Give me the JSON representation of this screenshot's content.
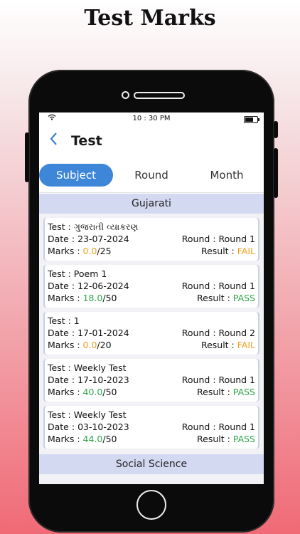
{
  "headline": "Test Marks",
  "status_bar": {
    "time": "10 : 30 PM"
  },
  "appbar": {
    "title": "Test"
  },
  "tabs": [
    "Subject",
    "Round",
    "Month"
  ],
  "labels": {
    "test": "Test",
    "date": "Date",
    "marks": "Marks",
    "round": "Round",
    "result": "Result",
    "sep": " : "
  },
  "sections": [
    {
      "name": "Gujarati",
      "items": [
        {
          "test": "ગુજરાતી વ્યાકરણ",
          "date": "23-07-2024",
          "round": "Round 1",
          "marks": "0.0",
          "total": "/25",
          "result": "FAIL"
        },
        {
          "test": "Poem 1",
          "date": "12-06-2024",
          "round": "Round 1",
          "marks": "18.0",
          "total": "/50",
          "result": "PASS"
        },
        {
          "test": "1",
          "date": "17-01-2024",
          "round": "Round 2",
          "marks": "0.0",
          "total": "/20",
          "result": "FAIL"
        },
        {
          "test": "Weekly Test",
          "date": "17-10-2023",
          "round": "Round 1",
          "marks": "40.0",
          "total": "/50",
          "result": "PASS"
        },
        {
          "test": "Weekly Test",
          "date": "03-10-2023",
          "round": "Round 1",
          "marks": "44.0",
          "total": "/50",
          "result": "PASS"
        }
      ]
    },
    {
      "name": "Social Science",
      "items": []
    }
  ]
}
